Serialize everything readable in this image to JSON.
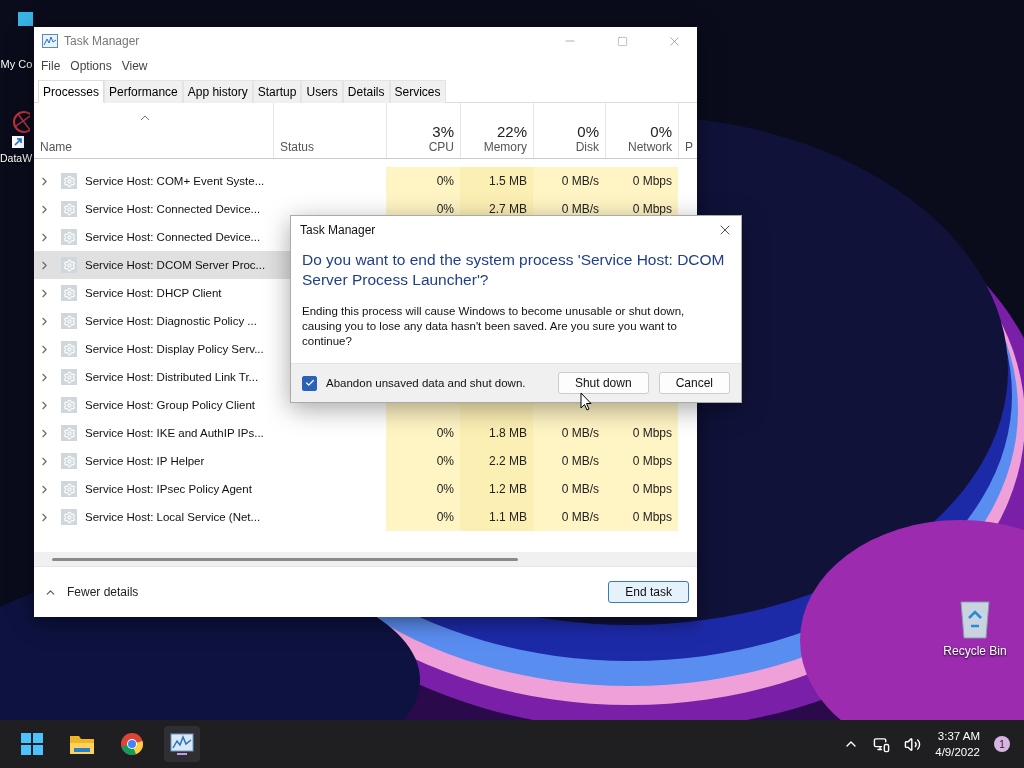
{
  "desktop_icons": [
    {
      "label": "My Co"
    },
    {
      "label": "DataW"
    },
    {
      "label": "Recycle Bin"
    }
  ],
  "window": {
    "title": "Task Manager",
    "menu": [
      "File",
      "Options",
      "View"
    ],
    "tabs": [
      {
        "label": "Processes",
        "selected": true
      },
      {
        "label": "Performance",
        "selected": false
      },
      {
        "label": "App history",
        "selected": false
      },
      {
        "label": "Startup",
        "selected": false
      },
      {
        "label": "Users",
        "selected": false
      },
      {
        "label": "Details",
        "selected": false
      },
      {
        "label": "Services",
        "selected": false
      }
    ],
    "columns": [
      {
        "label": "Name"
      },
      {
        "label": "Status"
      },
      {
        "label": "CPU",
        "usage": "3%"
      },
      {
        "label": "Memory",
        "usage": "22%"
      },
      {
        "label": "Disk",
        "usage": "0%"
      },
      {
        "label": "Network",
        "usage": "0%"
      },
      {
        "label": "P"
      }
    ],
    "rows": [
      {
        "name": "Service Host: COM+ Event Syste...",
        "selected": false,
        "cpu": "0%",
        "memory": "1.5 MB",
        "disk": "0 MB/s",
        "network": "0 Mbps"
      },
      {
        "name": "Service Host: Connected Device...",
        "selected": false,
        "cpu": "0%",
        "memory": "2.7 MB",
        "disk": "0 MB/s",
        "network": "0 Mbps"
      },
      {
        "name": "Service Host: Connected Device...",
        "selected": false
      },
      {
        "name": "Service Host: DCOM Server Proc...",
        "selected": true
      },
      {
        "name": "Service Host: DHCP Client",
        "selected": false
      },
      {
        "name": "Service Host: Diagnostic Policy ...",
        "selected": false
      },
      {
        "name": "Service Host: Display Policy Serv...",
        "selected": false
      },
      {
        "name": "Service Host: Distributed Link Tr...",
        "selected": false
      },
      {
        "name": "Service Host: Group Policy Client",
        "selected": false
      },
      {
        "name": "Service Host: IKE and AuthIP IPs...",
        "selected": false,
        "cpu": "0%",
        "memory": "1.8 MB",
        "disk": "0 MB/s",
        "network": "0 Mbps"
      },
      {
        "name": "Service Host: IP Helper",
        "selected": false,
        "cpu": "0%",
        "memory": "2.2 MB",
        "disk": "0 MB/s",
        "network": "0 Mbps"
      },
      {
        "name": "Service Host: IPsec Policy Agent",
        "selected": false,
        "cpu": "0%",
        "memory": "1.2 MB",
        "disk": "0 MB/s",
        "network": "0 Mbps"
      },
      {
        "name": "Service Host: Local Service (Net...",
        "selected": false,
        "cpu": "0%",
        "memory": "1.1 MB",
        "disk": "0 MB/s",
        "network": "0 Mbps"
      }
    ],
    "footer": {
      "toggle": "Fewer details",
      "button": "End task"
    }
  },
  "dialog": {
    "title": "Task Manager",
    "heading": "Do you want to end the system process 'Service Host: DCOM Server Process Launcher'?",
    "body": "Ending this process will cause Windows to become unusable or shut down, causing you to lose any data hasn't been saved. Are you sure you want to continue?",
    "checkbox": {
      "label": "Abandon unsaved data and shut down.",
      "checked": true
    },
    "buttons": [
      "Shut down",
      "Cancel"
    ]
  },
  "taskbar": {
    "time": "3:37 AM",
    "date": "4/9/2022",
    "notifications": "1"
  }
}
